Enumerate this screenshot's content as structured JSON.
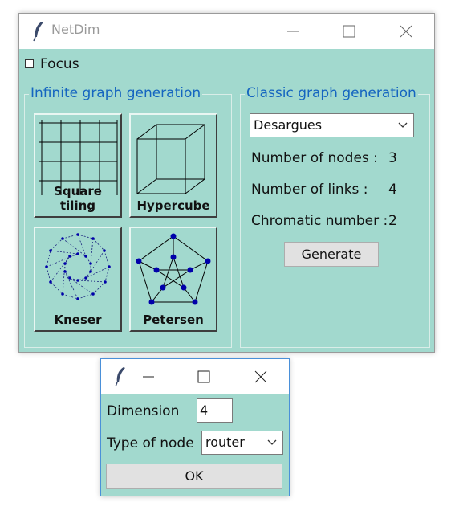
{
  "main_window": {
    "title": "NetDim",
    "focus_label": "Focus",
    "infinite_group": {
      "title": "Infinite graph generation",
      "tiles": [
        {
          "label": "Square tiling",
          "icon": "square-tiling-icon"
        },
        {
          "label": "Hypercube",
          "icon": "hypercube-icon"
        },
        {
          "label": "Kneser",
          "icon": "kneser-graph-icon"
        },
        {
          "label": "Petersen",
          "icon": "petersen-graph-icon"
        }
      ]
    },
    "classic_group": {
      "title": "Classic graph generation",
      "graph_select_value": "Desargues",
      "nodes_label": "Number of nodes :",
      "nodes_value": "3",
      "links_label": "Number of links :",
      "links_value": "4",
      "chromatic_label": "Chromatic number :",
      "chromatic_value": "2",
      "generate_label": "Generate"
    }
  },
  "dialog": {
    "dimension_label": "Dimension",
    "dimension_value": "4",
    "node_type_label": "Type of node",
    "node_type_value": "router",
    "ok_label": "OK"
  },
  "colors": {
    "background": "#a2d9ce",
    "group_title": "#1565c0",
    "graph_node": "#0000aa"
  }
}
